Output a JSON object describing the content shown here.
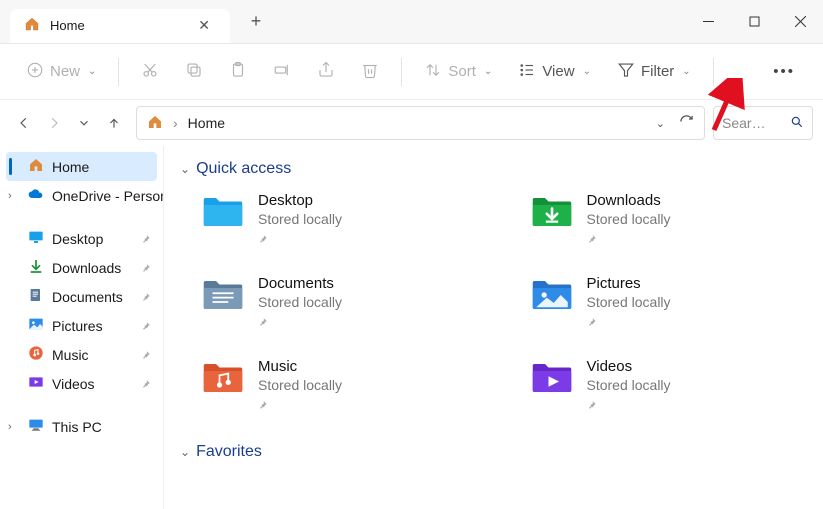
{
  "titlebar": {
    "tab_title": "Home"
  },
  "toolbar": {
    "new_label": "New",
    "sort_label": "Sort",
    "view_label": "View",
    "filter_label": "Filter"
  },
  "breadcrumb": {
    "current": "Home"
  },
  "search": {
    "placeholder": "Search Home"
  },
  "sidebar": {
    "home": "Home",
    "onedrive": "OneDrive - Personal",
    "desktop": "Desktop",
    "downloads": "Downloads",
    "documents": "Documents",
    "pictures": "Pictures",
    "music": "Music",
    "videos": "Videos",
    "thispc": "This PC"
  },
  "sections": {
    "quick_access": "Quick access",
    "favorites": "Favorites"
  },
  "quick_items": [
    {
      "name": "Desktop",
      "sub": "Stored locally"
    },
    {
      "name": "Downloads",
      "sub": "Stored locally"
    },
    {
      "name": "Documents",
      "sub": "Stored locally"
    },
    {
      "name": "Pictures",
      "sub": "Stored locally"
    },
    {
      "name": "Music",
      "sub": "Stored locally"
    },
    {
      "name": "Videos",
      "sub": "Stored locally"
    }
  ]
}
